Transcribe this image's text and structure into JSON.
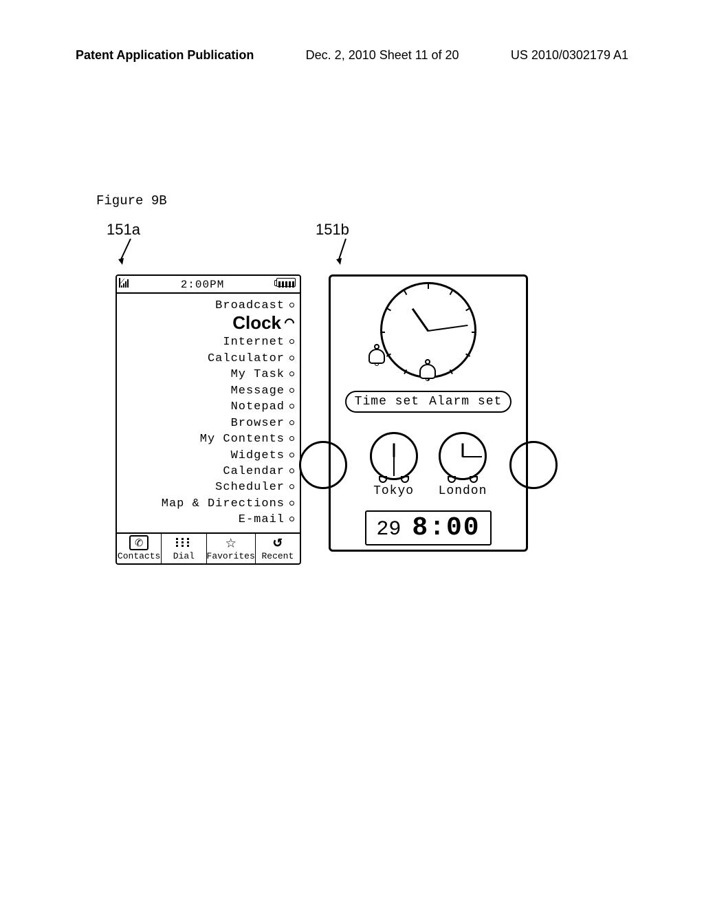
{
  "header": {
    "left": "Patent Application Publication",
    "center": "Dec. 2, 2010   Sheet 11 of 20",
    "right": "US 2010/0302179 A1"
  },
  "figure_label": "Figure 9B",
  "refs": {
    "a": "151a",
    "b": "151b"
  },
  "statusbar": {
    "time": "2:00PM"
  },
  "menu": {
    "items": [
      "Broadcast",
      "Clock",
      "Internet",
      "Calculator",
      "My Task",
      "Message",
      "Notepad",
      "Browser",
      "My Contents",
      "Widgets",
      "Calendar",
      "Scheduler",
      "Map & Directions",
      "E-mail"
    ]
  },
  "tabs": {
    "contacts": "Contacts",
    "dial": "Dial",
    "favorites": "Favorites",
    "recent": "Recent"
  },
  "panelB": {
    "timeset": "Time set",
    "alarmset": "Alarm set",
    "cities": {
      "tokyo": "Tokyo",
      "london": "London"
    },
    "digital": {
      "day": "29",
      "time": "8:00"
    }
  }
}
